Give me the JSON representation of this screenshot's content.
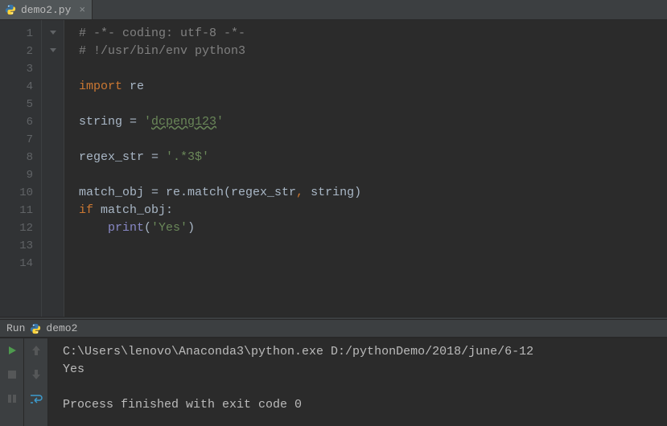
{
  "tab": {
    "filename": "demo2.py"
  },
  "editor": {
    "lines": [
      {
        "n": 1,
        "tokens": [
          {
            "t": "# -*- coding: utf-8 -*-",
            "c": "tok-comment"
          }
        ],
        "fold": true
      },
      {
        "n": 2,
        "tokens": [
          {
            "t": "# !/usr/bin/env python3",
            "c": "tok-comment"
          }
        ],
        "fold": true
      },
      {
        "n": 3,
        "tokens": []
      },
      {
        "n": 4,
        "tokens": [
          {
            "t": "import ",
            "c": "tok-kw"
          },
          {
            "t": "re",
            "c": "tok-default"
          }
        ]
      },
      {
        "n": 5,
        "tokens": []
      },
      {
        "n": 6,
        "tokens": [
          {
            "t": "string = ",
            "c": "tok-default"
          },
          {
            "t": "'",
            "c": "tok-str"
          },
          {
            "t": "dcpeng123",
            "c": "tok-typo"
          },
          {
            "t": "'",
            "c": "tok-str"
          }
        ]
      },
      {
        "n": 7,
        "tokens": []
      },
      {
        "n": 8,
        "tokens": [
          {
            "t": "regex_str = ",
            "c": "tok-default"
          },
          {
            "t": "'.*3$'",
            "c": "tok-str"
          }
        ]
      },
      {
        "n": 9,
        "tokens": []
      },
      {
        "n": 10,
        "tokens": [
          {
            "t": "match_obj = re.match(regex_str",
            "c": "tok-default"
          },
          {
            "t": ", ",
            "c": "tok-kw"
          },
          {
            "t": "string)",
            "c": "tok-default"
          }
        ]
      },
      {
        "n": 11,
        "tokens": [
          {
            "t": "if ",
            "c": "tok-kw"
          },
          {
            "t": "match_obj:",
            "c": "tok-default"
          }
        ]
      },
      {
        "n": 12,
        "tokens": [
          {
            "t": "    ",
            "c": "tok-default"
          },
          {
            "t": "print",
            "c": "tok-builtin"
          },
          {
            "t": "(",
            "c": "tok-default"
          },
          {
            "t": "'Yes'",
            "c": "tok-str"
          },
          {
            "t": ")",
            "c": "tok-default"
          }
        ]
      },
      {
        "n": 13,
        "tokens": []
      },
      {
        "n": 14,
        "tokens": []
      }
    ]
  },
  "run": {
    "label": "Run",
    "config": "demo2",
    "console": [
      "C:\\Users\\lenovo\\Anaconda3\\python.exe D:/pythonDemo/2018/june/6-12",
      "Yes",
      "",
      "Process finished with exit code 0"
    ]
  }
}
